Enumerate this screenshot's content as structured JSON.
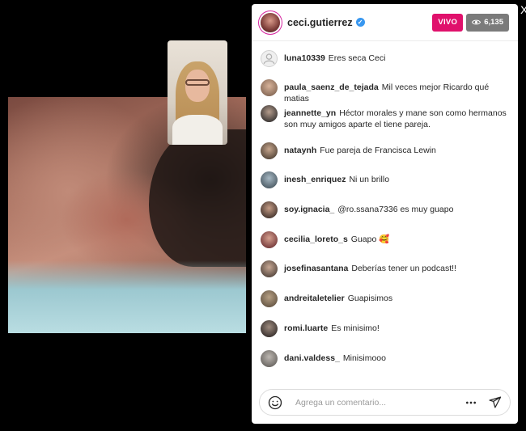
{
  "header": {
    "host_name": "ceci.gutierrez",
    "live_label": "VIVO",
    "viewer_count": "6,135",
    "verified_icon": "verified-check-icon",
    "eye_icon": "eye-icon"
  },
  "comments": [
    {
      "user": "luna10339",
      "text": "Eres seca Ceci",
      "avatar": "placeholder"
    },
    {
      "user": "paula_saenz_de_tejada",
      "text": "Mil veces mejor Ricardo qué matias",
      "avatar": "photo"
    },
    {
      "user": "jeannette_yn",
      "text": "Héctor morales y mane son como hermanos son muy amigos aparte el tiene pareja.",
      "avatar": "photo"
    },
    {
      "user": "nataynh",
      "text": "Fue pareja de Francisca Lewin",
      "avatar": "photo"
    },
    {
      "user": "inesh_enriquez",
      "text": "Ni un brillo",
      "avatar": "photo"
    },
    {
      "user": "soy.ignacia_",
      "text": "@ro.ssana7336 es muy guapo",
      "avatar": "photo"
    },
    {
      "user": "cecilia_loreto_s",
      "text": "Guapo 🥰",
      "avatar": "photo"
    },
    {
      "user": "josefinasantana",
      "text": "Deberías tener un podcast!!",
      "avatar": "photo"
    },
    {
      "user": "andreitaletelier",
      "text": "Guapisimos",
      "avatar": "photo"
    },
    {
      "user": "romi.luarte",
      "text": "Es minisimo!",
      "avatar": "photo"
    },
    {
      "user": "dani.valdess_",
      "text": "Minisimooo",
      "avatar": "photo"
    }
  ],
  "composer": {
    "placeholder": "Agrega un comentario...",
    "emoji_icon": "emoji-smiley-icon",
    "more_icon": "more-dots-icon",
    "send_icon": "send-paper-plane-icon"
  },
  "colors": {
    "live": "#e0116c",
    "viewer_badge": "#7b7b7b",
    "verified": "#3897f0",
    "background": "#000000",
    "panel": "#ffffff"
  },
  "close_icon": "close-icon",
  "close_glyph": "X"
}
